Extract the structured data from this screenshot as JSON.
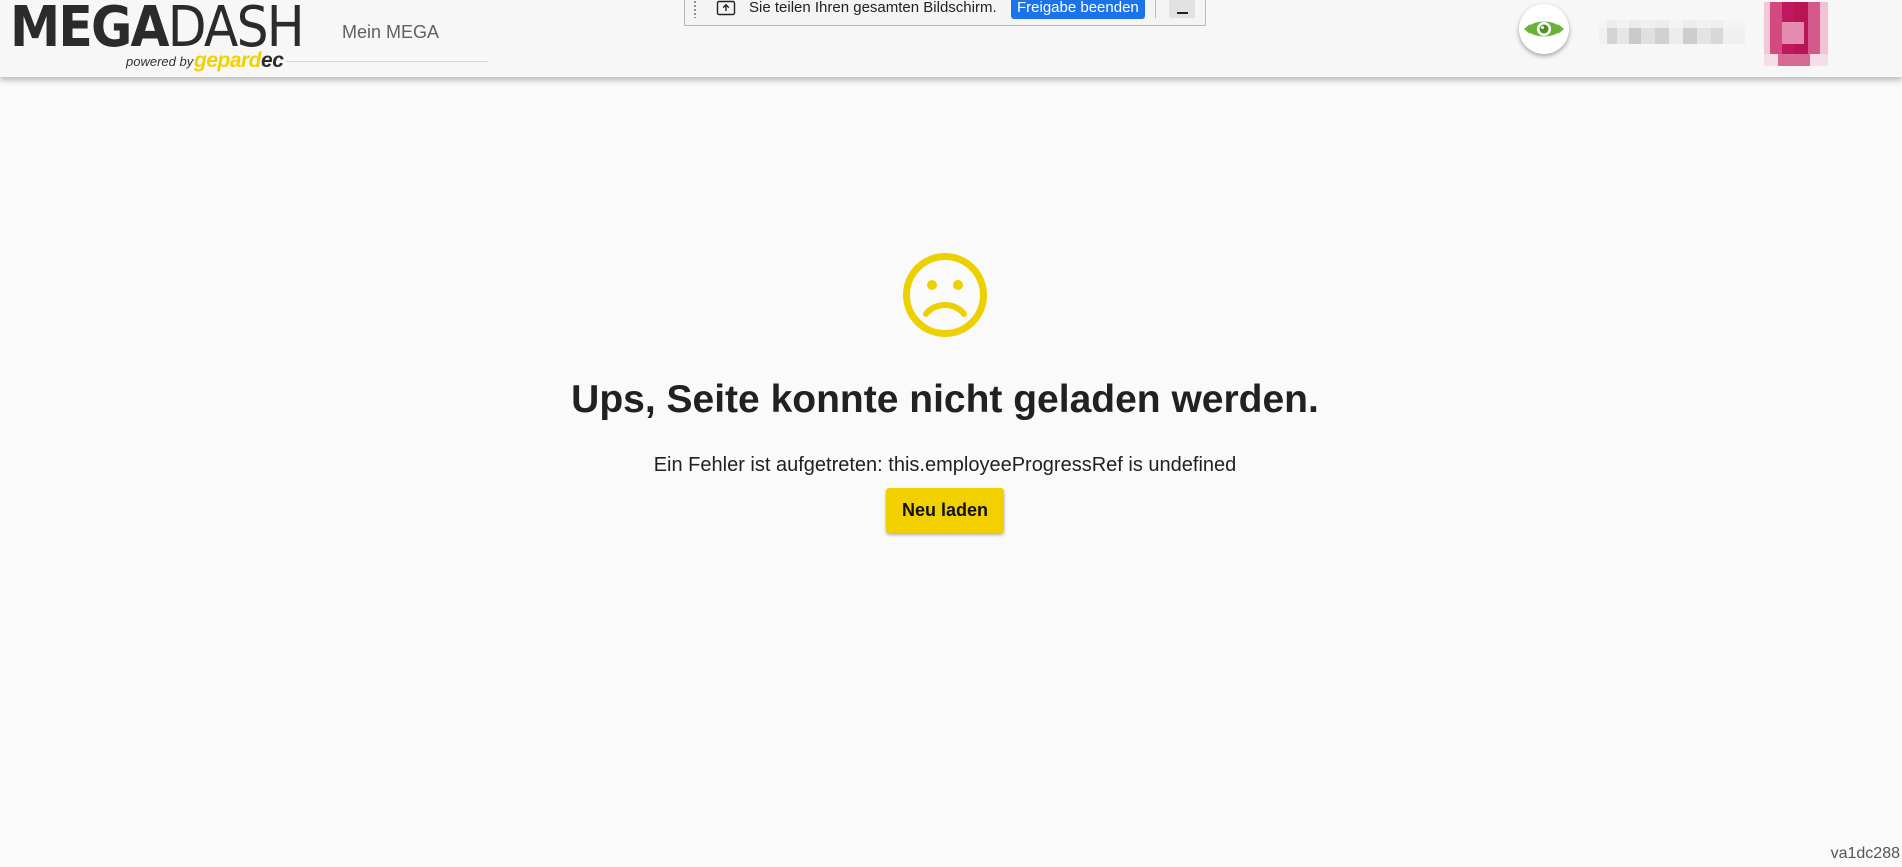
{
  "header": {
    "logo": {
      "mega": "MEGA",
      "dash": "DASH",
      "powered_by": "powered by",
      "brand_gepard": "gepard",
      "brand_ec": "ec"
    },
    "nav": {
      "mein_mega": "Mein MEGA"
    },
    "screen_share": {
      "message": "Sie teilen Ihren gesamten Bildschirm.",
      "stop_button": "Freigabe beenden"
    },
    "view_toggle_icon": "eye-icon",
    "colors": {
      "brand_yellow": "#f2d000",
      "toggle_green": "#6ab23c",
      "share_blue": "#1a73e8"
    }
  },
  "error": {
    "icon": "sad-face-icon",
    "title": "Ups, Seite konnte nicht geladen werden.",
    "message": "Ein Fehler ist aufgetreten: this.employeeProgressRef is undefined",
    "reload_button": "Neu laden"
  },
  "footer": {
    "version": "va1dc288"
  }
}
